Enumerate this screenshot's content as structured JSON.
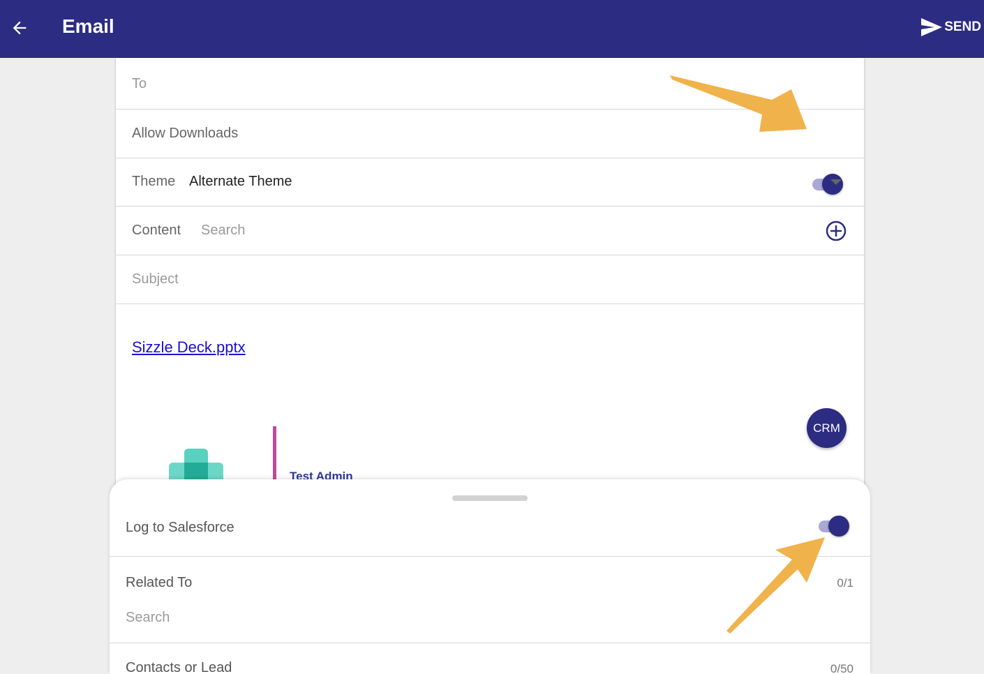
{
  "header": {
    "title": "Email",
    "send_label": "SEND",
    "back_icon": "arrow-left-icon",
    "send_icon": "send-icon"
  },
  "form": {
    "to_label": "To",
    "allow_downloads_label": "Allow Downloads",
    "allow_downloads_on": true,
    "theme_label": "Theme",
    "theme_value": "Alternate Theme",
    "content_label": "Content",
    "content_search_placeholder": "Search",
    "subject_placeholder": "Subject"
  },
  "body": {
    "attachment_link": "Sizzle Deck.pptx",
    "crm_button": "CRM",
    "signature_name": "Test Admin"
  },
  "sheet": {
    "log_label": "Log to Salesforce",
    "log_on": true,
    "related_label": "Related To",
    "related_count": "0/1",
    "related_search_placeholder": "Search",
    "contacts_label": "Contacts or Lead",
    "contacts_count": "0/50"
  },
  "colors": {
    "primary": "#2c2c82",
    "link": "#1a0dcc",
    "annotation_arrow": "#f0b24a",
    "signature_bar": "#c04a9a",
    "logo_teal": "#3cc9b4"
  }
}
